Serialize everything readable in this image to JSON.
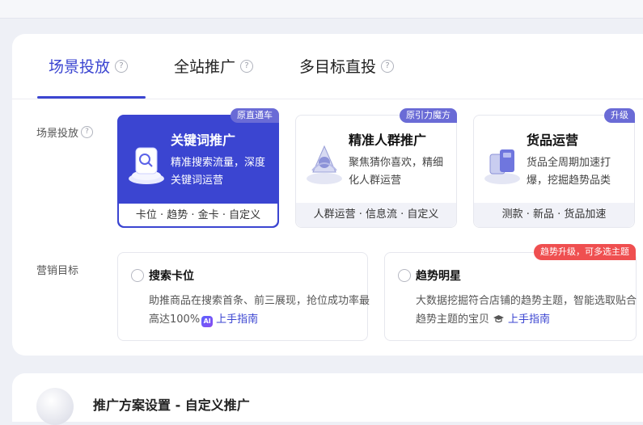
{
  "tabs": [
    {
      "label": "场景投放",
      "active": true
    },
    {
      "label": "全站推广",
      "active": false
    },
    {
      "label": "多目标直投",
      "active": false
    }
  ],
  "help_glyph": "?",
  "scene": {
    "label": "场景投放",
    "cards": [
      {
        "title": "关键词推广",
        "badge": "原直通车",
        "desc": "精准搜索流量，深度关键词运营",
        "footer": "卡位 · 趋势 · 金卡 · 自定义",
        "icon": "keyword-icon",
        "active": true
      },
      {
        "title": "精准人群推广",
        "badge": "原引力魔方",
        "desc": "聚焦猜你喜欢，精细化人群运营",
        "footer": "人群运营 · 信息流 · 自定义",
        "icon": "audience-icon",
        "active": false
      },
      {
        "title": "货品运营",
        "badge": "升级",
        "desc": "货品全周期加速打爆，挖掘趋势品类",
        "footer": "测款 · 新品 · 货品加速",
        "icon": "goods-icon",
        "active": false
      }
    ]
  },
  "goal": {
    "label": "营销目标",
    "cards": [
      {
        "title": "搜索卡位",
        "desc": "助推商品在搜索首条、前三展现，抢位成功率最高达100%",
        "ai_tag": "AI",
        "guide": "上手指南"
      },
      {
        "title": "趋势明星",
        "desc": "大数据挖掘符合店铺的趋势主题，智能选取贴合趋势主题的宝贝",
        "guide": "上手指南",
        "badge": "趋势升级，可多选主题"
      }
    ]
  },
  "section2": {
    "title": "推广方案设置 - 自定义推广"
  },
  "colors": {
    "accent": "#3b45d1",
    "badge": "#6a6bd6",
    "red": "#ef4f50"
  }
}
